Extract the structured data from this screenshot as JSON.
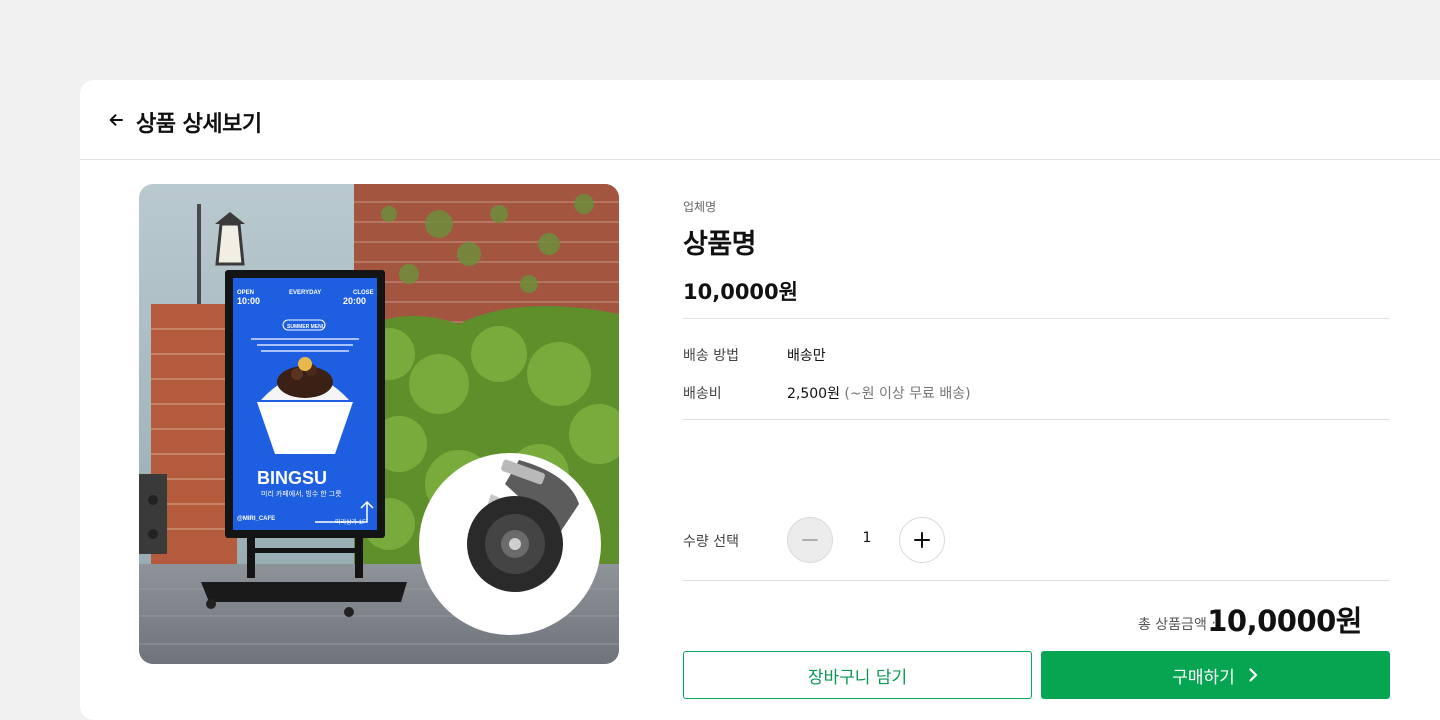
{
  "header": {
    "title": "상품 상세보기",
    "back_icon": "arrow-left-icon"
  },
  "product": {
    "image_alt": "BINGSU 입간판 제품 이미지",
    "vendor": "업체명",
    "name": "상품명",
    "price": "10,0000원"
  },
  "delivery": {
    "method_label": "배송 방법",
    "method_value": "배송만",
    "fee_label": "배송비",
    "fee_value": "2,500원",
    "fee_note": "(~원 이상 무료 배송)"
  },
  "quantity": {
    "label": "수량 선택",
    "value": "1"
  },
  "total": {
    "label": "총 상품금액 :",
    "value": "10,0000원"
  },
  "actions": {
    "cart_label": "장바구니 담기",
    "buy_label": "구매하기"
  },
  "colors": {
    "accent": "#05a552",
    "background": "#f1f1f1"
  },
  "poster_text": {
    "open_label": "OPEN",
    "open_time": "10:00",
    "everyday": "EVERYDAY",
    "close_label": "CLOSE",
    "close_time": "20:00",
    "badge": "SUMMER MENU",
    "headline": "BINGSU",
    "subline": "미리 카페에서, 빙수 한 그릇",
    "handle": "@MIRI_CAFE",
    "floor": "미리상가 1F"
  }
}
